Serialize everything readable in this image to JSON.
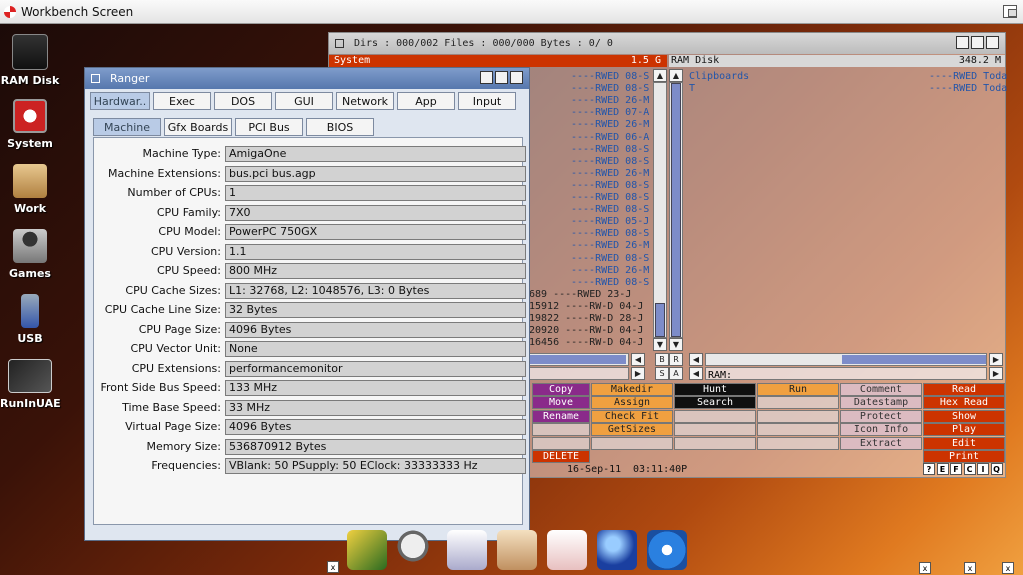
{
  "workbench": {
    "title": "Workbench Screen"
  },
  "desktop_icons": [
    {
      "name": "ram-disk-icon",
      "label": "RAM Disk"
    },
    {
      "name": "system-icon",
      "label": "System"
    },
    {
      "name": "work-icon",
      "label": "Work"
    },
    {
      "name": "games-icon",
      "label": "Games"
    },
    {
      "name": "usb-icon",
      "label": "USB"
    },
    {
      "name": "runinuae-icon",
      "label": "RunInUAE"
    }
  ],
  "ranger": {
    "title": "Ranger",
    "tabs": [
      "Hardwar..",
      "Exec",
      "DOS",
      "GUI",
      "Network",
      "App",
      "Input"
    ],
    "subtabs": [
      "Machine",
      "Gfx Boards",
      "PCI Bus",
      "BIOS"
    ],
    "rows": [
      {
        "k": "Machine Type:",
        "v": "AmigaOne"
      },
      {
        "k": "Machine Extensions:",
        "v": "bus.pci bus.agp"
      },
      {
        "k": "Number of CPUs:",
        "v": "1"
      },
      {
        "k": "CPU Family:",
        "v": "7X0"
      },
      {
        "k": "CPU Model:",
        "v": "PowerPC 750GX"
      },
      {
        "k": "CPU Version:",
        "v": "1.1"
      },
      {
        "k": "CPU Speed:",
        "v": "800 MHz"
      },
      {
        "k": "CPU Cache Sizes:",
        "v": "L1: 32768, L2: 1048576, L3: 0 Bytes"
      },
      {
        "k": "CPU Cache Line Size:",
        "v": "32 Bytes"
      },
      {
        "k": "CPU Page Size:",
        "v": "4096 Bytes"
      },
      {
        "k": "CPU Vector Unit:",
        "v": "None"
      },
      {
        "k": "CPU Extensions:",
        "v": "performancemonitor"
      },
      {
        "k": "Front Side Bus Speed:",
        "v": "133 MHz"
      },
      {
        "k": "Time Base Speed:",
        "v": "33 MHz"
      },
      {
        "k": "Virtual Page Size:",
        "v": "4096 Bytes"
      },
      {
        "k": "Memory Size:",
        "v": "536870912 Bytes"
      },
      {
        "k": "Frequencies:",
        "v": "VBlank: 50 PSupply: 50 EClock: 33333333 Hz"
      }
    ]
  },
  "filemanager": {
    "title": "Dirs : 000/002  Files : 000/000  Bytes :      0/     0",
    "left_header": "System",
    "left_size": "1.5 G",
    "right_header": "RAM Disk",
    "right_size": "348.2 M",
    "left_rows": [
      {
        "t": "----RWED 08-S",
        "file": false
      },
      {
        "t": "----RWED 08-S",
        "file": false
      },
      {
        "t": "----RWED 26-M",
        "file": false
      },
      {
        "t": "----RWED 07-A",
        "file": false
      },
      {
        "t": "----RWED 26-M",
        "file": false
      },
      {
        "t": "----RWED 06-A",
        "file": false
      },
      {
        "t": "----RWED 08-S",
        "file": false
      },
      {
        "t": "----RWED 08-S",
        "file": false
      },
      {
        "t": "----RWED 26-M",
        "file": false
      },
      {
        "t": "----RWED 08-S",
        "file": false
      },
      {
        "t": "----RWED 08-S",
        "file": false
      },
      {
        "t": "----RWED 08-S",
        "file": false
      },
      {
        "t": "----RWED 05-J",
        "file": false
      },
      {
        "t": "----RWED 08-S",
        "file": false
      },
      {
        "t": "----RWED 26-M",
        "file": false
      },
      {
        "t": "----RWED 08-S",
        "file": false
      },
      {
        "t": "----RWED 26-M",
        "file": false
      },
      {
        "t": "----RWED 08-S",
        "file": false
      },
      {
        "t": "689 ----RWED 23-J",
        "file": true
      },
      {
        "t": "15912 ----RW-D 04-J",
        "file": true
      },
      {
        "t": "19822 ----RW-D 28-J",
        "file": true
      },
      {
        "t": "20920 ----RW-D 04-J",
        "file": true
      },
      {
        "t": "16456 ----RW-D 04-J",
        "file": true
      }
    ],
    "right_rows": [
      {
        "name": "Clipboards",
        "attr": "----RWED Toda"
      },
      {
        "name": "T",
        "attr": "----RWED Toda"
      }
    ],
    "left_path": "",
    "right_path": "RAM:",
    "mid_buttons_1": [
      "B",
      "R"
    ],
    "mid_buttons_2": [
      "S",
      "A"
    ],
    "buttons": {
      "col1": [
        "Copy",
        "Move",
        "Rename",
        "",
        "",
        "DELETE"
      ],
      "col2": [
        "Makedir",
        "Assign",
        "Check Fit",
        "GetSizes",
        ""
      ],
      "col3": [
        "Hunt",
        "Search",
        "",
        "",
        ""
      ],
      "col4": [
        "Run",
        "",
        "",
        "",
        ""
      ],
      "col5": [
        "Comment",
        "Datestamp",
        "Protect",
        "Icon Info",
        "Extract"
      ],
      "col6": [
        "Read",
        "Hex Read",
        "Show",
        "Play",
        "Edit",
        "Print"
      ]
    },
    "date": "16-Sep-11",
    "time": "03:11:40P",
    "small_buttons": [
      "?",
      "E",
      "F",
      "C",
      "I",
      "Q"
    ]
  },
  "colors": {
    "red": "#cc3300",
    "orange": "#f0a040",
    "purple": "#8a2a8a",
    "dir_blue": "#2255aa",
    "title_blue": "#5677ad"
  },
  "dock": {
    "icons": [
      "pencil-icon",
      "magnifier-icon",
      "notepad-icon",
      "jar-icon",
      "gift-icon",
      "sphere-icon",
      "play-icon"
    ],
    "close_label": "x",
    "right_labels": [
      "x",
      "x",
      "x"
    ]
  }
}
